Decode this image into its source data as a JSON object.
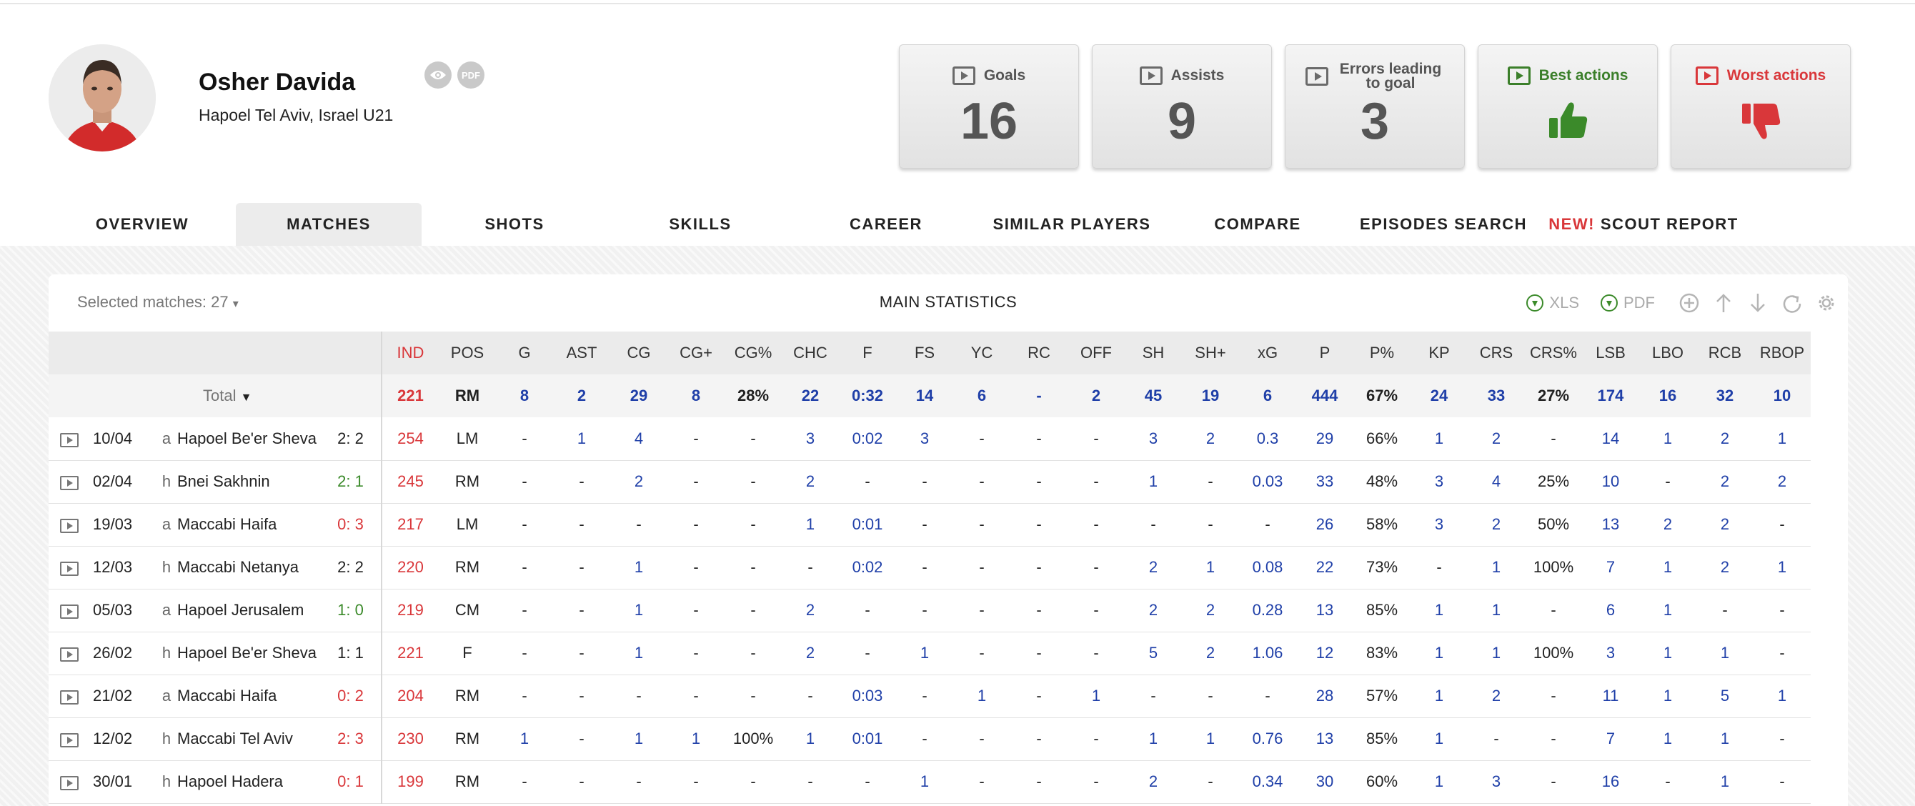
{
  "player": {
    "name": "Osher Davida",
    "clubs": "Hapoel Tel Aviv,  Israel U21",
    "pdf_label": "PDF"
  },
  "cards": [
    {
      "title": "Goals",
      "value": "16"
    },
    {
      "title": "Assists",
      "value": "9"
    },
    {
      "title": "Errors leading to goal",
      "value": "3"
    },
    {
      "title": "Best actions"
    },
    {
      "title": "Worst actions"
    }
  ],
  "tabs": [
    "OVERVIEW",
    "MATCHES",
    "SHOTS",
    "SKILLS",
    "CAREER",
    "SIMILAR PLAYERS",
    "COMPARE",
    "EPISODES SEARCH",
    "SCOUT REPORT"
  ],
  "tab_new": "NEW!",
  "panel": {
    "selected": "Selected matches: 27",
    "title": "MAIN STATISTICS",
    "xls": "XLS",
    "pdf": "PDF"
  },
  "columns": [
    "IND",
    "POS",
    "G",
    "AST",
    "CG",
    "CG+",
    "CG%",
    "CHC",
    "F",
    "FS",
    "YC",
    "RC",
    "OFF",
    "SH",
    "SH+",
    "xG",
    "P",
    "P%",
    "KP",
    "CRS",
    "CRS%",
    "LSB",
    "LBO",
    "RCB",
    "RBOP"
  ],
  "total": {
    "label": "Total",
    "values": [
      "221",
      "RM",
      "8",
      "2",
      "29",
      "8",
      "28%",
      "22",
      "0:32",
      "14",
      "6",
      "-",
      "2",
      "45",
      "19",
      "6",
      "444",
      "67%",
      "24",
      "33",
      "27%",
      "174",
      "16",
      "32",
      "10"
    ]
  },
  "matches": [
    {
      "date": "10/04",
      "ha": "a",
      "opponent": "Hapoel Be'er Sheva",
      "score": "2: 2",
      "result": "draw",
      "values": [
        "254",
        "LM",
        "-",
        "1",
        "4",
        "-",
        "-",
        "3",
        "0:02",
        "3",
        "-",
        "-",
        "-",
        "3",
        "2",
        "0.3",
        "29",
        "66%",
        "1",
        "2",
        "-",
        "14",
        "1",
        "2",
        "1"
      ]
    },
    {
      "date": "02/04",
      "ha": "h",
      "opponent": "Bnei Sakhnin",
      "score": "2: 1",
      "result": "win",
      "values": [
        "245",
        "RM",
        "-",
        "-",
        "2",
        "-",
        "-",
        "2",
        "-",
        "-",
        "-",
        "-",
        "-",
        "1",
        "-",
        "0.03",
        "33",
        "48%",
        "3",
        "4",
        "25%",
        "10",
        "-",
        "2",
        "2"
      ]
    },
    {
      "date": "19/03",
      "ha": "a",
      "opponent": "Maccabi Haifa",
      "score": "0: 3",
      "result": "loss",
      "values": [
        "217",
        "LM",
        "-",
        "-",
        "-",
        "-",
        "-",
        "1",
        "0:01",
        "-",
        "-",
        "-",
        "-",
        "-",
        "-",
        "-",
        "26",
        "58%",
        "3",
        "2",
        "50%",
        "13",
        "2",
        "2",
        "-"
      ]
    },
    {
      "date": "12/03",
      "ha": "h",
      "opponent": "Maccabi Netanya",
      "score": "2: 2",
      "result": "draw",
      "values": [
        "220",
        "RM",
        "-",
        "-",
        "1",
        "-",
        "-",
        "-",
        "0:02",
        "-",
        "-",
        "-",
        "-",
        "2",
        "1",
        "0.08",
        "22",
        "73%",
        "-",
        "1",
        "100%",
        "7",
        "1",
        "2",
        "1"
      ]
    },
    {
      "date": "05/03",
      "ha": "a",
      "opponent": "Hapoel Jerusalem",
      "score": "1: 0",
      "result": "win",
      "values": [
        "219",
        "CM",
        "-",
        "-",
        "1",
        "-",
        "-",
        "2",
        "-",
        "-",
        "-",
        "-",
        "-",
        "2",
        "2",
        "0.28",
        "13",
        "85%",
        "1",
        "1",
        "-",
        "6",
        "1",
        "-",
        "-"
      ]
    },
    {
      "date": "26/02",
      "ha": "h",
      "opponent": "Hapoel Be'er Sheva",
      "score": "1: 1",
      "result": "draw",
      "values": [
        "221",
        "F",
        "-",
        "-",
        "1",
        "-",
        "-",
        "2",
        "-",
        "1",
        "-",
        "-",
        "-",
        "5",
        "2",
        "1.06",
        "12",
        "83%",
        "1",
        "1",
        "100%",
        "3",
        "1",
        "1",
        "-"
      ]
    },
    {
      "date": "21/02",
      "ha": "a",
      "opponent": "Maccabi Haifa",
      "score": "0: 2",
      "result": "loss",
      "values": [
        "204",
        "RM",
        "-",
        "-",
        "-",
        "-",
        "-",
        "-",
        "0:03",
        "-",
        "1",
        "-",
        "1",
        "-",
        "-",
        "-",
        "28",
        "57%",
        "1",
        "2",
        "-",
        "11",
        "1",
        "5",
        "1"
      ]
    },
    {
      "date": "12/02",
      "ha": "h",
      "opponent": "Maccabi Tel Aviv",
      "score": "2: 3",
      "result": "loss",
      "values": [
        "230",
        "RM",
        "1",
        "-",
        "1",
        "1",
        "100%",
        "1",
        "0:01",
        "-",
        "-",
        "-",
        "-",
        "1",
        "1",
        "0.76",
        "13",
        "85%",
        "1",
        "-",
        "-",
        "7",
        "1",
        "1",
        "-"
      ]
    },
    {
      "date": "30/01",
      "ha": "h",
      "opponent": "Hapoel Hadera",
      "score": "0: 1",
      "result": "loss",
      "values": [
        "199",
        "RM",
        "-",
        "-",
        "-",
        "-",
        "-",
        "-",
        "-",
        "1",
        "-",
        "-",
        "-",
        "2",
        "-",
        "0.34",
        "30",
        "60%",
        "1",
        "3",
        "-",
        "16",
        "-",
        "1",
        "-"
      ]
    }
  ]
}
